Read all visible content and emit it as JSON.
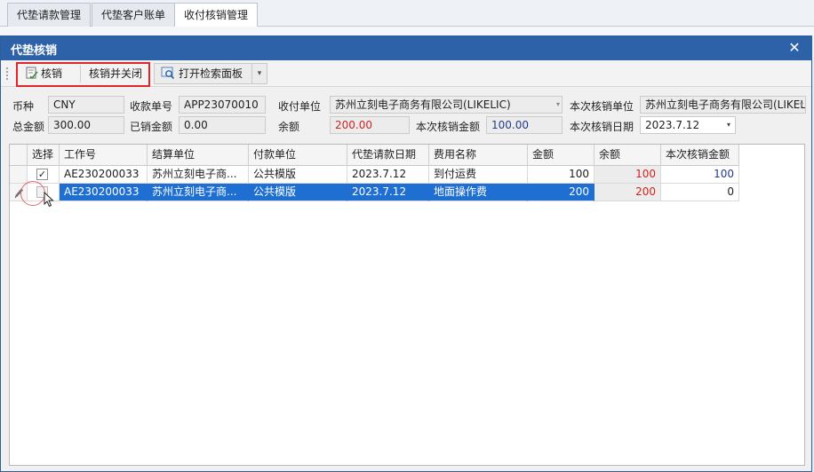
{
  "background_tabs": [
    {
      "label": "代垫请款管理"
    },
    {
      "label": "代垫客户账单"
    },
    {
      "label": "收付核销管理"
    }
  ],
  "dialog": {
    "title": "代垫核销",
    "close_glyph": "✕"
  },
  "toolbar": {
    "verify_label": "核销",
    "verify_close_label": "核销并关闭",
    "search_panel_label": "打开检索面板",
    "dropdown_glyph": "▾"
  },
  "form": {
    "currency_label": "币种",
    "currency_value": "CNY",
    "receipt_no_label": "收款单号",
    "receipt_no_value": "APP23070010",
    "payee_label": "收付单位",
    "payee_value": "苏州立刻电子商务有限公司(LIKELIC)",
    "this_unit_label": "本次核销单位",
    "this_unit_value": "苏州立刻电子商务有限公司(LIKELIC)",
    "total_label": "总金额",
    "total_value": "300.00",
    "verified_label": "已销金额",
    "verified_value": "0.00",
    "balance_label": "余额",
    "balance_value": "200.00",
    "this_amount_label": "本次核销金额",
    "this_amount_value": "100.00",
    "this_date_label": "本次核销日期",
    "this_date_value": "2023.7.12",
    "combo_glyph": "▾"
  },
  "grid": {
    "columns": [
      "选择",
      "工作号",
      "结算单位",
      "付款单位",
      "代垫请款日期",
      "费用名称",
      "金额",
      "余额",
      "本次核销金额"
    ],
    "rows": [
      {
        "checked": "✓",
        "job_no": "AE230200033",
        "settle_unit": "苏州立刻电子商...",
        "pay_unit": "公共模版",
        "date": "2023.7.12",
        "fee_name": "到付运费",
        "amount": "100",
        "balance": "100",
        "this_amount": "100"
      },
      {
        "checked": "",
        "job_no": "AE230200033",
        "settle_unit": "苏州立刻电子商...",
        "pay_unit": "公共模版",
        "date": "2023.7.12",
        "fee_name": "地面操作费",
        "amount": "200",
        "balance": "200",
        "this_amount": "0"
      }
    ]
  },
  "colors": {
    "title_bar": "#2d62a8",
    "selection": "#1e6fd1",
    "highlight_border": "#e0262a",
    "balance_red": "#d42020",
    "amount_blue": "#1f3a8f"
  }
}
